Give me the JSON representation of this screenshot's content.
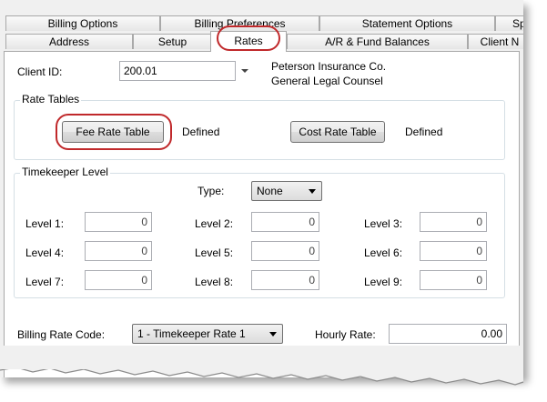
{
  "tabs_row1": [
    "Billing Options",
    "Billing Preferences",
    "Statement Options",
    "Spi"
  ],
  "tabs_row2": [
    "Address",
    "Setup",
    "Rates",
    "A/R & Fund Balances",
    "Client N"
  ],
  "client": {
    "label": "Client ID:",
    "value": "200.01",
    "name_line1": "Peterson Insurance Co.",
    "name_line2": "General Legal Counsel"
  },
  "rate_tables": {
    "legend": "Rate Tables",
    "fee_button": "Fee Rate Table",
    "fee_status": "Defined",
    "cost_button": "Cost Rate Table",
    "cost_status": "Defined"
  },
  "timekeeper": {
    "legend": "Timekeeper Level",
    "type_label": "Type:",
    "type_value": "None",
    "levels": [
      {
        "label": "Level 1:",
        "value": "0"
      },
      {
        "label": "Level 2:",
        "value": "0"
      },
      {
        "label": "Level 3:",
        "value": "0"
      },
      {
        "label": "Level 4:",
        "value": "0"
      },
      {
        "label": "Level 5:",
        "value": "0"
      },
      {
        "label": "Level 6:",
        "value": "0"
      },
      {
        "label": "Level 7:",
        "value": "0"
      },
      {
        "label": "Level 8:",
        "value": "0"
      },
      {
        "label": "Level 9:",
        "value": "0"
      }
    ]
  },
  "billing": {
    "code_label": "Billing Rate Code:",
    "code_value": "1 - Timekeeper Rate 1",
    "hourly_label": "Hourly Rate:",
    "hourly_value": "0.00"
  },
  "colors": {
    "highlight_ring": "#c0292b",
    "panel_background": "#ffffff",
    "window_background": "#f0f0f0"
  }
}
